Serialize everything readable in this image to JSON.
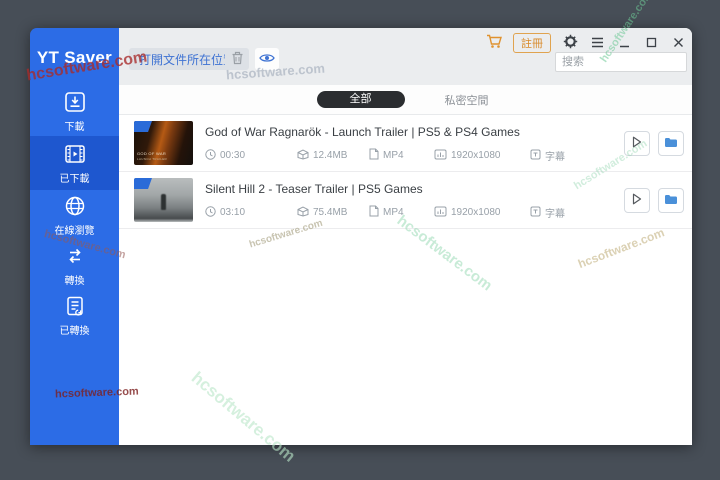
{
  "app": {
    "title": "YT Saver"
  },
  "sidebar": {
    "items": [
      {
        "label": "下載",
        "icon": "download-icon"
      },
      {
        "label": "已下載",
        "icon": "film-icon"
      },
      {
        "label": "在線瀏覽",
        "icon": "globe-icon"
      },
      {
        "label": "轉換",
        "icon": "convert-icon"
      },
      {
        "label": "已轉換",
        "icon": "converted-doc-icon"
      }
    ]
  },
  "toolbar": {
    "open_location": "打開文件所在位置",
    "register": "註冊",
    "search_placeholder": "搜索",
    "icons": [
      "trash-icon",
      "eye-icon",
      "cart-icon",
      "gear-icon",
      "menu-icon",
      "minimize-icon",
      "maximize-icon",
      "close-icon"
    ]
  },
  "tabs": {
    "all": "全部",
    "private": "私密空間"
  },
  "videos": [
    {
      "title": "God of War Ragnarök - Launch Trailer | PS5 & PS4 Games",
      "duration": "00:30",
      "size": "12.4MB",
      "format": "MP4",
      "resolution": "1920x1080",
      "subtitle": "字幕"
    },
    {
      "title": "Silent Hill 2 - Teaser Trailer | PS5 Games",
      "duration": "03:10",
      "size": "75.4MB",
      "format": "MP4",
      "resolution": "1920x1080",
      "subtitle": "字幕"
    }
  ],
  "thumbnail_captions": {
    "gow_line1": "GOD OF WAR",
    "gow_line2": "LAUNCH TRAILER"
  },
  "watermark": {
    "text": "hcsoftware.com"
  },
  "colors": {
    "sidebar": "#2c6ce6",
    "sidebar_active": "#1e57cf",
    "accent_orange": "#d98b2b",
    "link_blue": "#3f73d3",
    "tab_active_bg": "#2b2d30",
    "folder_blue": "#4a90d9",
    "outer_background": "#474e57"
  }
}
